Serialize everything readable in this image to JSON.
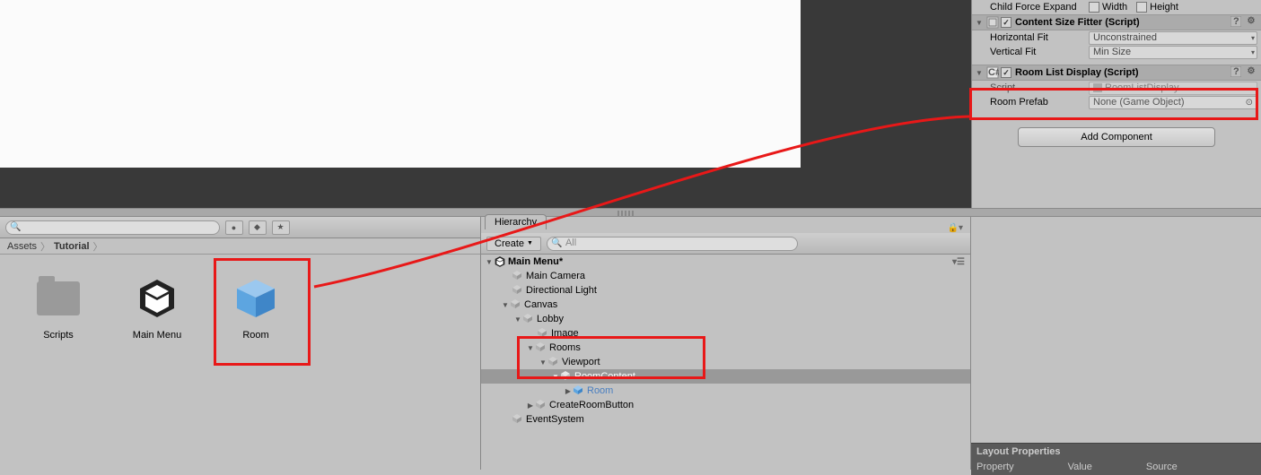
{
  "inspector": {
    "child_force_expand": {
      "label": "Child Force Expand",
      "width": "Width",
      "height": "Height"
    },
    "content_size_fitter": {
      "title": "Content Size Fitter (Script)",
      "horizontal_fit": {
        "label": "Horizontal Fit",
        "value": "Unconstrained"
      },
      "vertical_fit": {
        "label": "Vertical Fit",
        "value": "Min Size"
      }
    },
    "room_list_display": {
      "title": "Room List Display (Script)",
      "script": {
        "label": "Script",
        "value": "RoomListDisplay"
      },
      "room_prefab": {
        "label": "Room Prefab",
        "value": "None (Game Object)"
      }
    },
    "add_component": "Add Component",
    "layout_properties": {
      "title": "Layout Properties",
      "col1": "Property",
      "col2": "Value",
      "col3": "Source"
    }
  },
  "project": {
    "breadcrumb": [
      "Assets",
      "Tutorial"
    ],
    "items": [
      {
        "label": "Scripts",
        "type": "folder"
      },
      {
        "label": "Main Menu",
        "type": "scene"
      },
      {
        "label": "Room",
        "type": "prefab"
      }
    ]
  },
  "hierarchy": {
    "tab": "Hierarchy",
    "create": "Create",
    "search_placeholder": "All",
    "scene": "Main Menu*",
    "nodes": {
      "main_camera": "Main Camera",
      "directional_light": "Directional Light",
      "canvas": "Canvas",
      "lobby": "Lobby",
      "image": "Image",
      "rooms": "Rooms",
      "viewport": "Viewport",
      "room_content": "RoomContent",
      "room": "Room",
      "create_room_button": "CreateRoomButton",
      "event_system": "EventSystem"
    }
  }
}
